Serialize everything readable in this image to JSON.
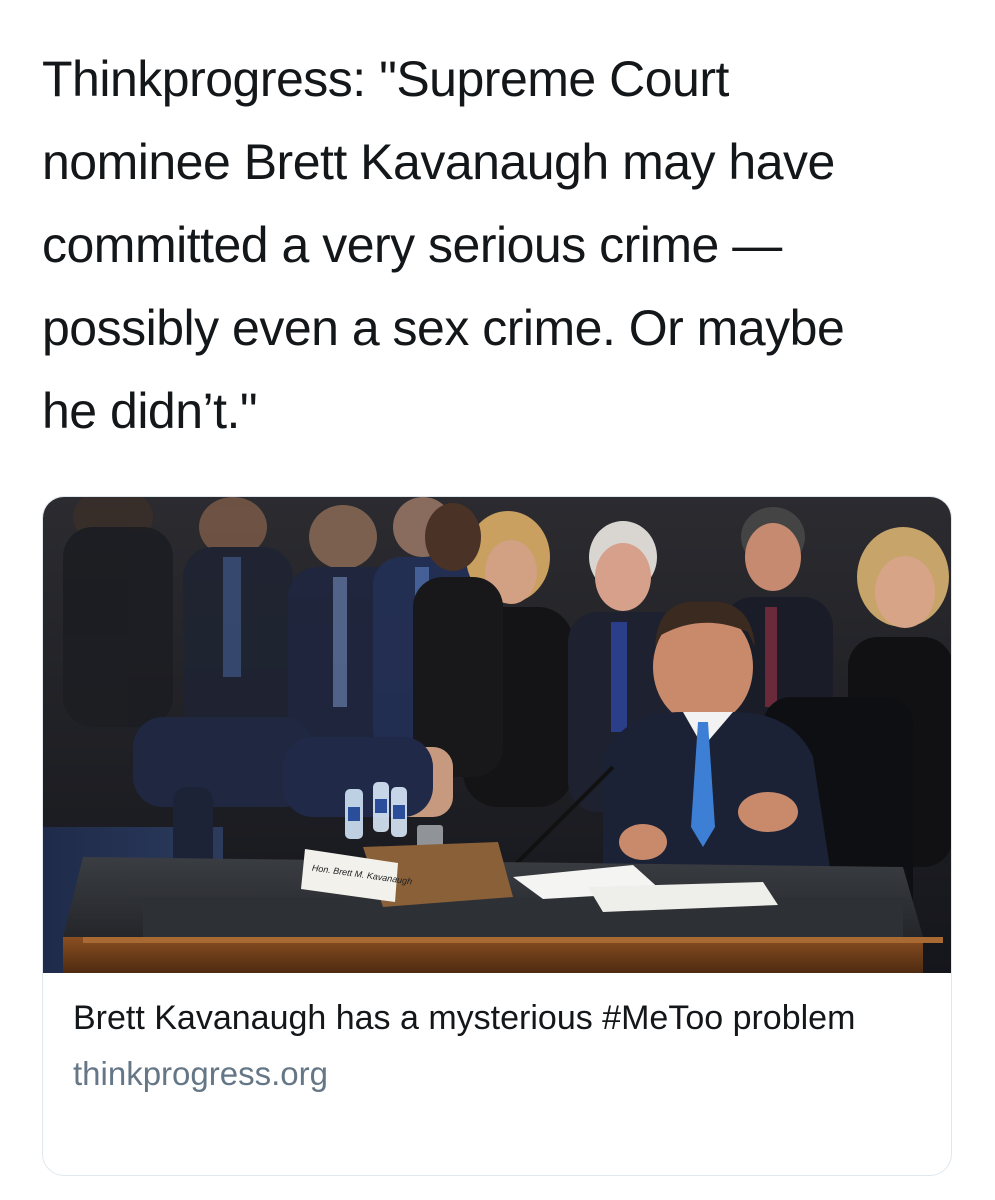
{
  "tweet": {
    "text_lines": [
      "Thinkprogress: \"Supreme Court",
      "nominee Brett Kavanaugh may have",
      "committed a very serious crime —",
      "possibly even a sex crime. Or maybe",
      "he didn’t.\""
    ]
  },
  "card": {
    "image_nameplate": "Hon. Brett M. Kavanaugh",
    "title": "Brett Kavanaugh has a mysterious #MeToo problem",
    "domain": "thinkprogress.org"
  }
}
